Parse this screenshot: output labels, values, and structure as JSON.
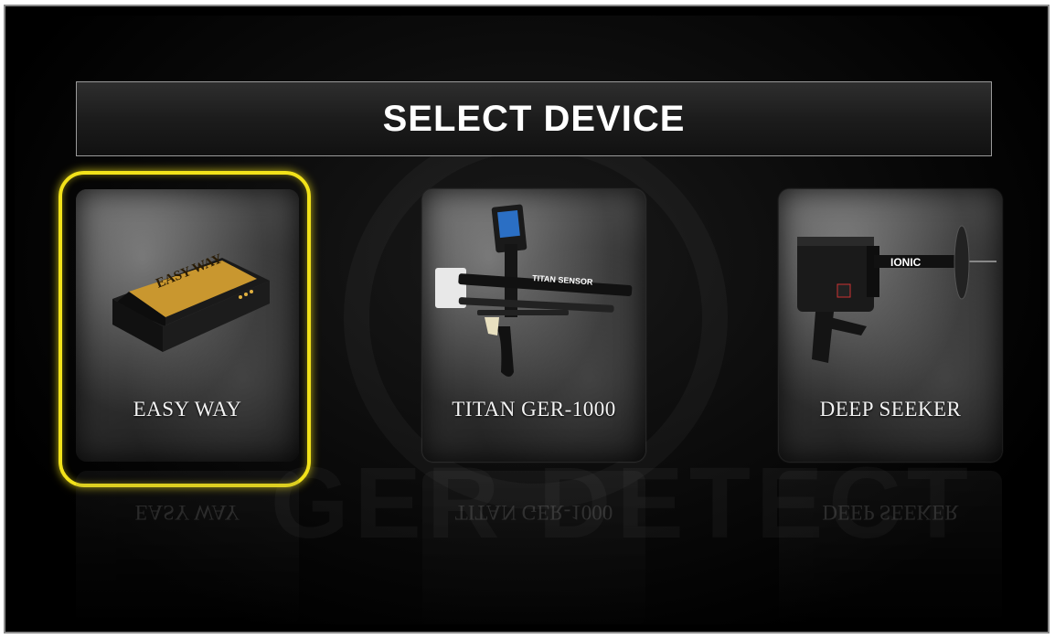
{
  "title": "SELECT DEVICE",
  "devices": [
    {
      "label": "EASY WAY",
      "icon": "easy-way-device-icon",
      "selected": true
    },
    {
      "label": "TITAN GER-1000",
      "icon": "titan-detector-icon",
      "selected": false,
      "art_text": "TITAN SENSOR"
    },
    {
      "label": "DEEP SEEKER",
      "icon": "deep-seeker-detector-icon",
      "selected": false,
      "art_text": "IONIC"
    }
  ],
  "easy_way_art_text": "EASY WAY",
  "colors": {
    "selection": "#f2e21a",
    "background": "#000000",
    "title_text": "#ffffff",
    "device_gold": "#c9972f"
  }
}
